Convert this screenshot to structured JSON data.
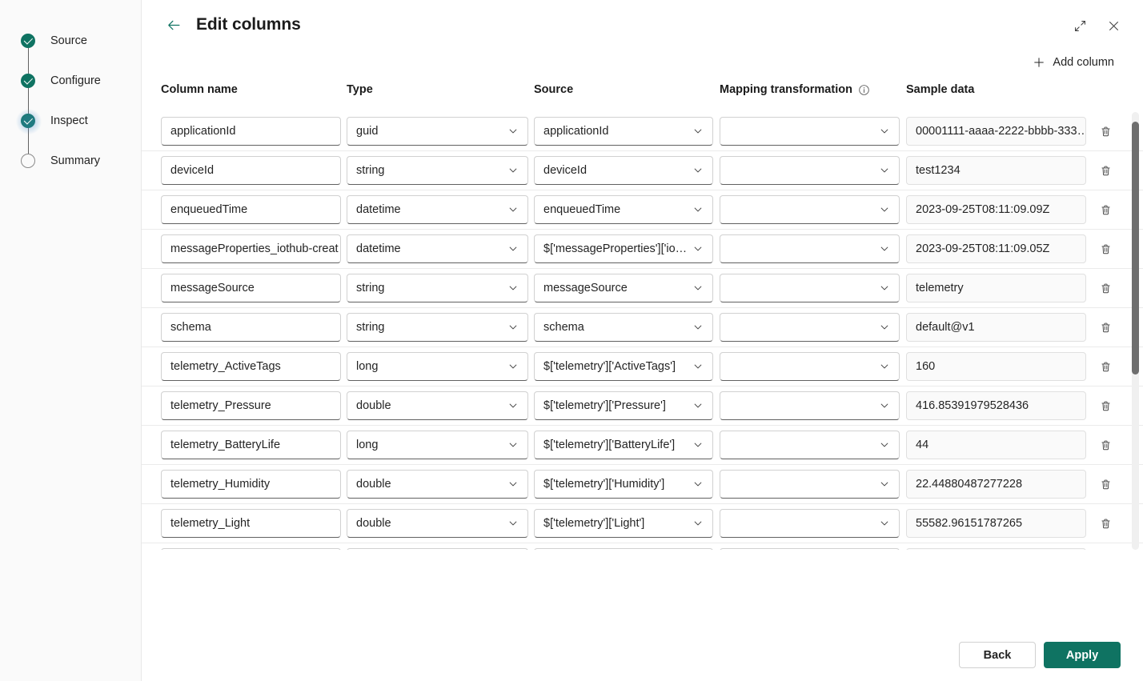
{
  "wizard": {
    "steps": [
      {
        "label": "Source",
        "state": "done",
        "focused": false
      },
      {
        "label": "Configure",
        "state": "done",
        "focused": false
      },
      {
        "label": "Inspect",
        "state": "done",
        "focused": true
      },
      {
        "label": "Summary",
        "state": "todo",
        "focused": false
      }
    ]
  },
  "header": {
    "title": "Edit columns",
    "back_icon": "arrow-left-icon",
    "expand_icon": "expand-diagonal-icon",
    "close_icon": "close-icon"
  },
  "toolbar": {
    "add_column_label": "Add column",
    "add_column_icon": "plus-icon"
  },
  "grid": {
    "headers": {
      "column_name": "Column name",
      "type": "Type",
      "source": "Source",
      "mapping_transformation": "Mapping transformation",
      "mapping_info_icon": "info-icon",
      "sample_data": "Sample data"
    },
    "delete_icon": "trash-icon",
    "chevron_icon": "chevron-down-icon",
    "rows": [
      {
        "column_name": "applicationId",
        "type": "guid",
        "source": "applicationId",
        "mapping_transformation": "",
        "sample_data": "00001111-aaaa-2222-bbbb-333…"
      },
      {
        "column_name": "deviceId",
        "type": "string",
        "source": "deviceId",
        "mapping_transformation": "",
        "sample_data": "test1234"
      },
      {
        "column_name": "enqueuedTime",
        "type": "datetime",
        "source": "enqueuedTime",
        "mapping_transformation": "",
        "sample_data": "2023-09-25T08:11:09.09Z"
      },
      {
        "column_name": "messageProperties_iothub-creat",
        "type": "datetime",
        "source": "$['messageProperties']['iothu",
        "mapping_transformation": "",
        "sample_data": "2023-09-25T08:11:09.05Z"
      },
      {
        "column_name": "messageSource",
        "type": "string",
        "source": "messageSource",
        "mapping_transformation": "",
        "sample_data": "telemetry"
      },
      {
        "column_name": "schema",
        "type": "string",
        "source": "schema",
        "mapping_transformation": "",
        "sample_data": "default@v1"
      },
      {
        "column_name": "telemetry_ActiveTags",
        "type": "long",
        "source": "$['telemetry']['ActiveTags']",
        "mapping_transformation": "",
        "sample_data": "160"
      },
      {
        "column_name": "telemetry_Pressure",
        "type": "double",
        "source": "$['telemetry']['Pressure']",
        "mapping_transformation": "",
        "sample_data": "416.85391979528436"
      },
      {
        "column_name": "telemetry_BatteryLife",
        "type": "long",
        "source": "$['telemetry']['BatteryLife']",
        "mapping_transformation": "",
        "sample_data": "44"
      },
      {
        "column_name": "telemetry_Humidity",
        "type": "double",
        "source": "$['telemetry']['Humidity']",
        "mapping_transformation": "",
        "sample_data": "22.44880487277228"
      },
      {
        "column_name": "telemetry_Light",
        "type": "double",
        "source": "$['telemetry']['Light']",
        "mapping_transformation": "",
        "sample_data": "55582.96151787265"
      },
      {
        "column_name": "",
        "type": "",
        "source": "",
        "mapping_transformation": "",
        "sample_data": ""
      }
    ]
  },
  "footer": {
    "back_label": "Back",
    "apply_label": "Apply"
  },
  "colors": {
    "accent": "#0f7362",
    "text": "#242424",
    "border": "#d1d1d1",
    "rail_bg": "#fafafa"
  }
}
